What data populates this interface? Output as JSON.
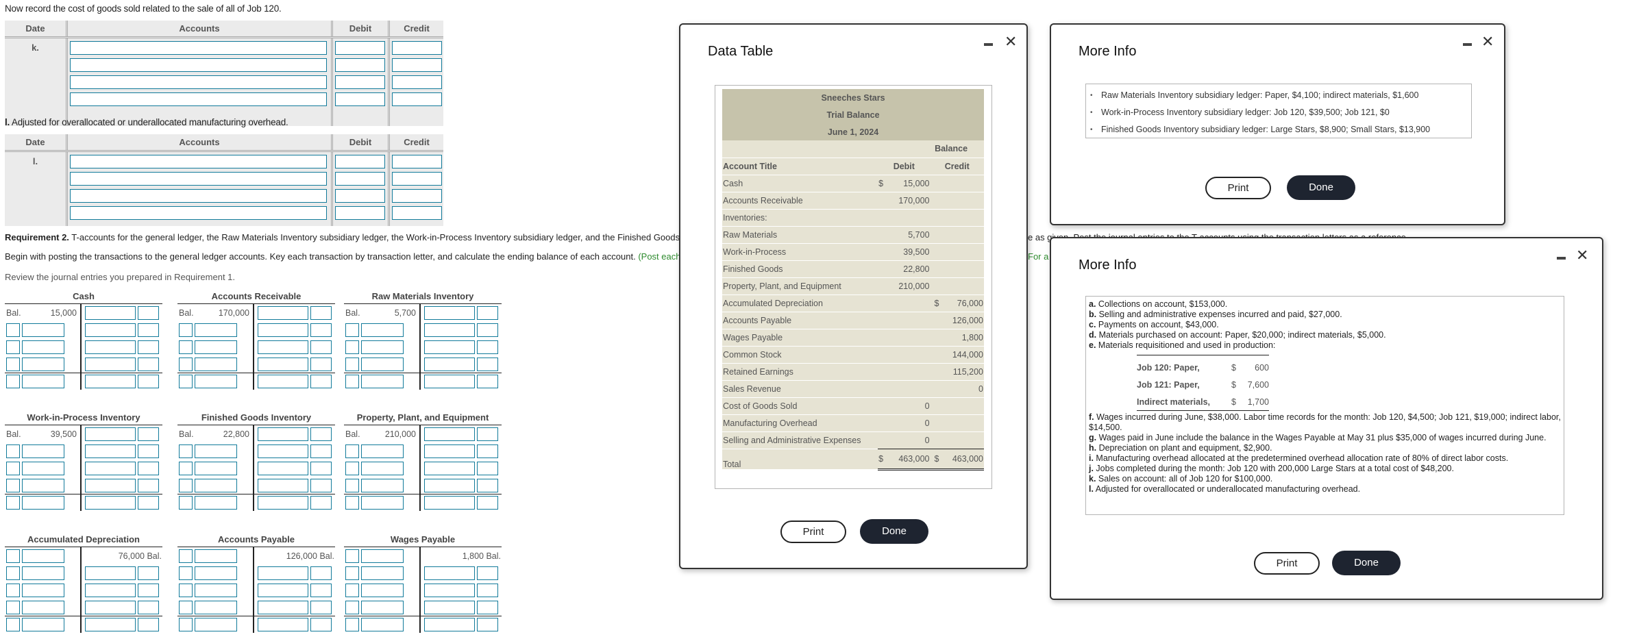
{
  "journal": {
    "k": {
      "instruction": "Now record the cost of goods sold related to the sale of all of Job 120.",
      "headers": [
        "Date",
        "Accounts",
        "Debit",
        "Credit"
      ],
      "date_label": "k.",
      "rows": 4
    },
    "l": {
      "instruction_bold": "l.",
      "instruction": " Adjusted for overallocated or underallocated manufacturing overhead.",
      "headers": [
        "Date",
        "Accounts",
        "Debit",
        "Credit"
      ],
      "date_label": "l.",
      "rows": 4
    }
  },
  "requirement2": {
    "bold": "Requirement 2.",
    "text": " T-accounts for the general ledger, the Raw Materials Inventory subsidiary ledger, the Work-in-Process Inventory subsidiary ledger, and the Finished Goods",
    "text_tail": "e as given. Post the journal entries to the T-accounts using the transaction letters as a reference.",
    "instruction": "Begin with posting the transactions to the general ledger accounts. Key each transaction by transaction letter, and calculate the ending balance of each account. ",
    "instruction_green": "(Post each",
    "instruction_green_tail": "For a",
    "review": "Review the journal entries you prepared in Requirement 1."
  },
  "t_accounts": [
    {
      "title": "Cash",
      "side": "debit",
      "bal_label": "Bal.",
      "balance": "15,000"
    },
    {
      "title": "Accounts Receivable",
      "side": "debit",
      "bal_label": "Bal.",
      "balance": "170,000"
    },
    {
      "title": "Raw Materials Inventory",
      "side": "debit",
      "bal_label": "Bal.",
      "balance": "5,700"
    },
    {
      "title": "Work-in-Process Inventory",
      "side": "debit",
      "bal_label": "Bal.",
      "balance": "39,500"
    },
    {
      "title": "Finished Goods Inventory",
      "side": "debit",
      "bal_label": "Bal.",
      "balance": "22,800"
    },
    {
      "title": "Property, Plant, and Equipment",
      "side": "debit",
      "bal_label": "Bal.",
      "balance": "210,000"
    },
    {
      "title": "Accumulated Depreciation",
      "side": "credit",
      "bal_label": "Bal.",
      "balance": "76,000"
    },
    {
      "title": "Accounts Payable",
      "side": "credit",
      "bal_label": "Bal.",
      "balance": "126,000"
    },
    {
      "title": "Wages Payable",
      "side": "credit",
      "bal_label": "Bal.",
      "balance": "1,800"
    }
  ],
  "data_table": {
    "title": "Data Table",
    "company": "Sneeches Stars",
    "report": "Trial Balance",
    "date": "June 1, 2024",
    "balance_header": "Balance",
    "col_title": "Account Title",
    "col_debit": "Debit",
    "col_credit": "Credit",
    "rows": [
      {
        "title": "Cash",
        "debit_sign": "$",
        "debit": "15,000",
        "credit_sign": "",
        "credit": ""
      },
      {
        "title": "Accounts Receivable",
        "debit_sign": "",
        "debit": "170,000",
        "credit_sign": "",
        "credit": ""
      },
      {
        "title": "Inventories:",
        "debit_sign": "",
        "debit": "",
        "credit_sign": "",
        "credit": ""
      },
      {
        "title": "Raw Materials",
        "indent": true,
        "debit_sign": "",
        "debit": "5,700",
        "credit_sign": "",
        "credit": ""
      },
      {
        "title": "Work-in-Process",
        "indent": true,
        "debit_sign": "",
        "debit": "39,500",
        "credit_sign": "",
        "credit": ""
      },
      {
        "title": "Finished Goods",
        "indent": true,
        "debit_sign": "",
        "debit": "22,800",
        "credit_sign": "",
        "credit": ""
      },
      {
        "title": "Property, Plant, and Equipment",
        "debit_sign": "",
        "debit": "210,000",
        "credit_sign": "",
        "credit": ""
      },
      {
        "title": "Accumulated Depreciation",
        "debit_sign": "",
        "debit": "",
        "credit_sign": "$",
        "credit": "76,000"
      },
      {
        "title": "Accounts Payable",
        "debit_sign": "",
        "debit": "",
        "credit_sign": "",
        "credit": "126,000"
      },
      {
        "title": "Wages Payable",
        "debit_sign": "",
        "debit": "",
        "credit_sign": "",
        "credit": "1,800"
      },
      {
        "title": "Common Stock",
        "debit_sign": "",
        "debit": "",
        "credit_sign": "",
        "credit": "144,000"
      },
      {
        "title": "Retained Earnings",
        "debit_sign": "",
        "debit": "",
        "credit_sign": "",
        "credit": "115,200"
      },
      {
        "title": "Sales Revenue",
        "debit_sign": "",
        "debit": "",
        "credit_sign": "",
        "credit": "0"
      },
      {
        "title": "Cost of Goods Sold",
        "debit_sign": "",
        "debit": "0",
        "credit_sign": "",
        "credit": ""
      },
      {
        "title": "Manufacturing Overhead",
        "debit_sign": "",
        "debit": "0",
        "credit_sign": "",
        "credit": ""
      },
      {
        "title": "Selling and Administrative Expenses",
        "debit_sign": "",
        "debit": "0",
        "credit_sign": "",
        "credit": "",
        "underline": true
      }
    ],
    "total": {
      "title": "Total",
      "debit_sign": "$",
      "debit": "463,000",
      "credit_sign": "$",
      "credit": "463,000"
    },
    "print_label": "Print",
    "done_label": "Done"
  },
  "more_info_1": {
    "title": "More Info",
    "items": [
      "Raw Materials Inventory subsidiary ledger: Paper, $4,100; indirect materials, $1,600",
      "Work-in-Process Inventory subsidiary ledger: Job 120, $39,500; Job 121, $0",
      "Finished Goods Inventory subsidiary ledger: Large Stars, $8,900; Small Stars, $13,900"
    ],
    "print_label": "Print",
    "done_label": "Done"
  },
  "more_info_2": {
    "title": "More Info",
    "transactions_before": [
      {
        "letter": "a.",
        "text": " Collections on account, $153,000."
      },
      {
        "letter": "b.",
        "text": " Selling and administrative expenses incurred and paid, $27,000."
      },
      {
        "letter": "c.",
        "text": " Payments on account, $43,000."
      },
      {
        "letter": "d.",
        "text": " Materials purchased on account: Paper, $20,000; indirect materials, $5,000."
      },
      {
        "letter": "e.",
        "text": " Materials requisitioned and used in production:"
      }
    ],
    "requisitions": [
      {
        "label": "Job 120: Paper,",
        "sign": "$",
        "amount": "600"
      },
      {
        "label": "Job 121: Paper,",
        "sign": "$",
        "amount": "7,600"
      },
      {
        "label": "Indirect materials,",
        "sign": "$",
        "amount": "1,700"
      }
    ],
    "transactions_after": [
      {
        "letter": "f.",
        "text": " Wages incurred during June, $38,000. Labor time records for the month: Job 120, $4,500; Job 121, $19,000; indirect labor, $14,500."
      },
      {
        "letter": "g.",
        "text": " Wages paid in June include the balance in the Wages Payable at May 31 plus $35,000 of wages incurred during June."
      },
      {
        "letter": "h.",
        "text": " Depreciation on plant and equipment, $2,900."
      },
      {
        "letter": "i.",
        "text": " Manufacturing overhead allocated at the predetermined overhead allocation rate of 80% of direct labor costs."
      },
      {
        "letter": "j.",
        "text": " Jobs completed during the month: Job 120 with 200,000 Large Stars at a total cost of $48,200."
      },
      {
        "letter": "k.",
        "text": " Sales on account: all of Job 120 for $100,000."
      },
      {
        "letter": "l.",
        "text": " Adjusted for overallocated or underallocated manufacturing overhead."
      }
    ],
    "print_label": "Print",
    "done_label": "Done"
  }
}
